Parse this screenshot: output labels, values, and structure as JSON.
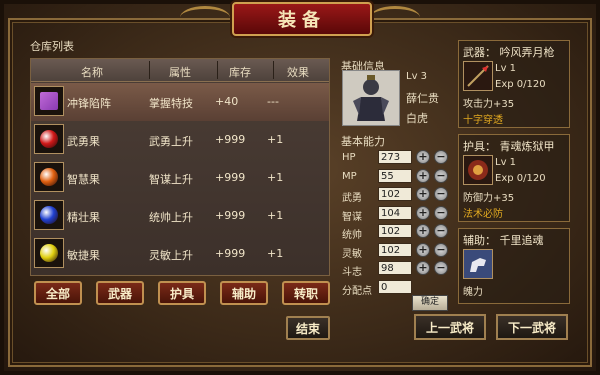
{
  "title": "装备",
  "warehouse": {
    "label": "仓库列表",
    "columns": [
      "名称",
      "属性",
      "库存",
      "效果"
    ],
    "rows": [
      {
        "name": "冲锋陷阵",
        "attr": "掌握特技",
        "stock": "+40",
        "effect": "---",
        "icon": "purple-book-icon",
        "color": "#8a3ab0"
      },
      {
        "name": "武勇果",
        "attr": "武勇上升",
        "stock": "+999",
        "effect": "+1",
        "icon": "red-fruit-icon",
        "color": "#d01818"
      },
      {
        "name": "智慧果",
        "attr": "智谋上升",
        "stock": "+999",
        "effect": "+1",
        "icon": "orange-fruit-icon",
        "color": "#e06010"
      },
      {
        "name": "精壮果",
        "attr": "统帅上升",
        "stock": "+999",
        "effect": "+1",
        "icon": "blue-fruit-icon",
        "color": "#2040d0"
      },
      {
        "name": "敏捷果",
        "attr": "灵敏上升",
        "stock": "+999",
        "effect": "+1",
        "icon": "yellow-fruit-icon",
        "color": "#e0d010"
      }
    ]
  },
  "tabs": [
    "全部",
    "武器",
    "护具",
    "辅助",
    "转职"
  ],
  "end_button": "结束",
  "basic_info": {
    "label": "基础信息",
    "level": "Lv 3",
    "name": "薛仁贵",
    "horse": "白虎"
  },
  "abilities": {
    "label": "基本能力",
    "stats": [
      {
        "label": "HP",
        "value": "273",
        "buttons": true
      },
      {
        "label": "MP",
        "value": "55",
        "buttons": true
      },
      {
        "label": "武勇",
        "value": "102",
        "buttons": true
      },
      {
        "label": "智谋",
        "value": "104",
        "buttons": true
      },
      {
        "label": "统帅",
        "value": "102",
        "buttons": true
      },
      {
        "label": "灵敏",
        "value": "102",
        "buttons": true
      },
      {
        "label": "斗志",
        "value": "98",
        "buttons": true
      },
      {
        "label": "分配点",
        "value": "0",
        "buttons": false
      }
    ],
    "confirm": "确定"
  },
  "weapon": {
    "header": "武器： 吟风弄月枪",
    "lv": "Lv  1",
    "exp": "Exp 0/120",
    "stat": "攻击力+35",
    "skill": "十字穿透"
  },
  "armor": {
    "header": "护具： 青魂炼狱甲",
    "lv": "Lv  1",
    "exp": "Exp 0/120",
    "stat": "防御力+35",
    "skill": "法术必防"
  },
  "accessory": {
    "header": "辅助： 千里追魂",
    "stat": "魄力"
  },
  "nav": {
    "prev": "上一武将",
    "next": "下一武将"
  },
  "plus": "+",
  "minus": "−"
}
